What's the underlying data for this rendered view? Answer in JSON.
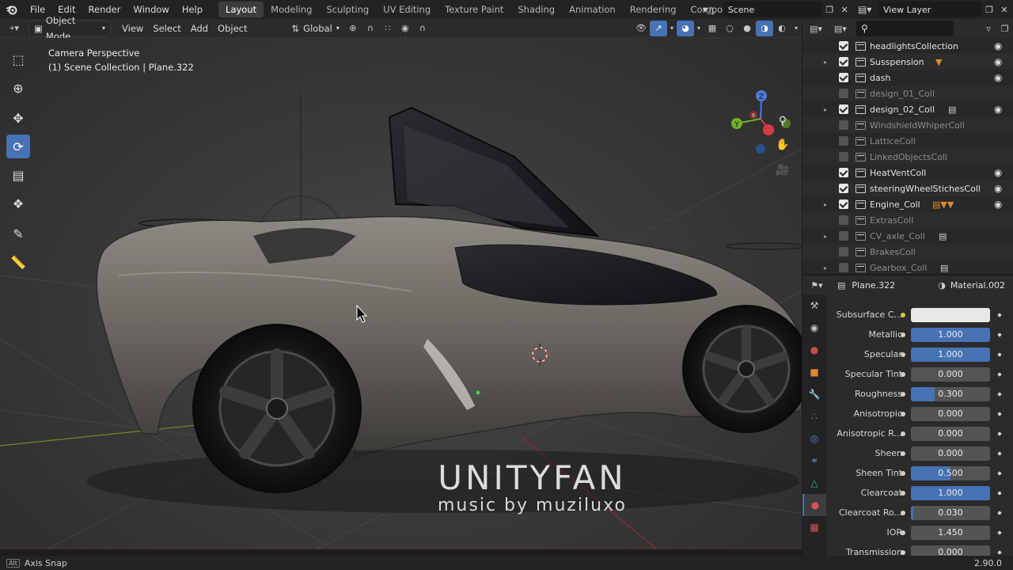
{
  "app": {
    "title": "Blender"
  },
  "menu": [
    "File",
    "Edit",
    "Render",
    "Window",
    "Help"
  ],
  "workspaces": [
    "Layout",
    "Modeling",
    "Sculpting",
    "UV Editing",
    "Texture Paint",
    "Shading",
    "Animation",
    "Rendering",
    "Compositing"
  ],
  "active_workspace": "Layout",
  "scene": {
    "label": "Scene"
  },
  "view_layer": {
    "label": "View Layer"
  },
  "header": {
    "mode": "Object Mode",
    "view": "View",
    "select": "Select",
    "add": "Add",
    "object": "Object",
    "orientation": "Global"
  },
  "viewport": {
    "info_line1": "Camera Perspective",
    "info_line2": "(1) Scene Collection | Plane.322"
  },
  "watermark": {
    "line1": "UNITYFAN",
    "line2": "music by muziluxo"
  },
  "outliner": {
    "search_placeholder": "",
    "items": [
      {
        "name": "headlightsCollection",
        "checked": true,
        "visible": true,
        "expander": false,
        "dim": false
      },
      {
        "name": "Susspension",
        "checked": true,
        "visible": true,
        "expander": true,
        "dim": false,
        "extra": "armature-icon"
      },
      {
        "name": "dash",
        "checked": true,
        "visible": true,
        "expander": false,
        "dim": false
      },
      {
        "name": "design_01_Coll",
        "checked": false,
        "visible": false,
        "expander": false,
        "dim": true
      },
      {
        "name": "design_02_Coll",
        "checked": true,
        "visible": true,
        "expander": true,
        "dim": false,
        "extra": "collection-icon"
      },
      {
        "name": "WindshieldWhiperColl",
        "checked": false,
        "visible": false,
        "expander": false,
        "dim": true
      },
      {
        "name": "LatticeColl",
        "checked": false,
        "visible": false,
        "expander": false,
        "dim": true
      },
      {
        "name": "LinkedObjectsColl",
        "checked": false,
        "visible": false,
        "expander": false,
        "dim": true
      },
      {
        "name": "HeatVentColl",
        "checked": true,
        "visible": true,
        "expander": false,
        "dim": false
      },
      {
        "name": "steeringWheelStichesColl",
        "checked": true,
        "visible": true,
        "expander": false,
        "dim": false
      },
      {
        "name": "Engine_Coll",
        "checked": true,
        "visible": true,
        "expander": true,
        "dim": false,
        "extra": "85 78"
      },
      {
        "name": "ExtrasColl",
        "checked": false,
        "visible": false,
        "expander": false,
        "dim": true
      },
      {
        "name": "CV_axle_Coll",
        "checked": false,
        "visible": false,
        "expander": true,
        "dim": true,
        "extra": "collection-icon"
      },
      {
        "name": "BrakesColl",
        "checked": false,
        "visible": false,
        "expander": false,
        "dim": true
      },
      {
        "name": "Gearbox_Coll",
        "checked": false,
        "visible": false,
        "expander": true,
        "dim": true,
        "extra": "2"
      }
    ]
  },
  "properties": {
    "object": "Plane.322",
    "material": "Material.002",
    "rows": [
      {
        "label": "Subsurface C...",
        "value": "",
        "fill": 0,
        "color_swatch": "#e8e8e8",
        "dot": "yellow"
      },
      {
        "label": "Metallic",
        "value": "1.000",
        "fill": 1.0
      },
      {
        "label": "Specular",
        "value": "1.000",
        "fill": 1.0
      },
      {
        "label": "Specular Tint",
        "value": "0.000",
        "fill": 0
      },
      {
        "label": "Roughness",
        "value": "0.300",
        "fill": 0.3
      },
      {
        "label": "Anisotropic",
        "value": "0.000",
        "fill": 0
      },
      {
        "label": "Anisotropic R...",
        "value": "0.000",
        "fill": 0
      },
      {
        "label": "Sheen",
        "value": "0.000",
        "fill": 0
      },
      {
        "label": "Sheen Tint",
        "value": "0.500",
        "fill": 0.5
      },
      {
        "label": "Clearcoat",
        "value": "1.000",
        "fill": 1.0
      },
      {
        "label": "Clearcoat Ro...",
        "value": "0.030",
        "fill": 0.03
      },
      {
        "label": "IOR",
        "value": "1.450",
        "fill": 0
      },
      {
        "label": "Transmission",
        "value": "0.000",
        "fill": 0
      }
    ]
  },
  "status": {
    "key": "Alt",
    "hint": "Axis Snap",
    "version": "2.90.0"
  },
  "colors": {
    "accent": "#4772b3",
    "bg": "#1d1d1d",
    "panel": "#2b2b2b"
  }
}
